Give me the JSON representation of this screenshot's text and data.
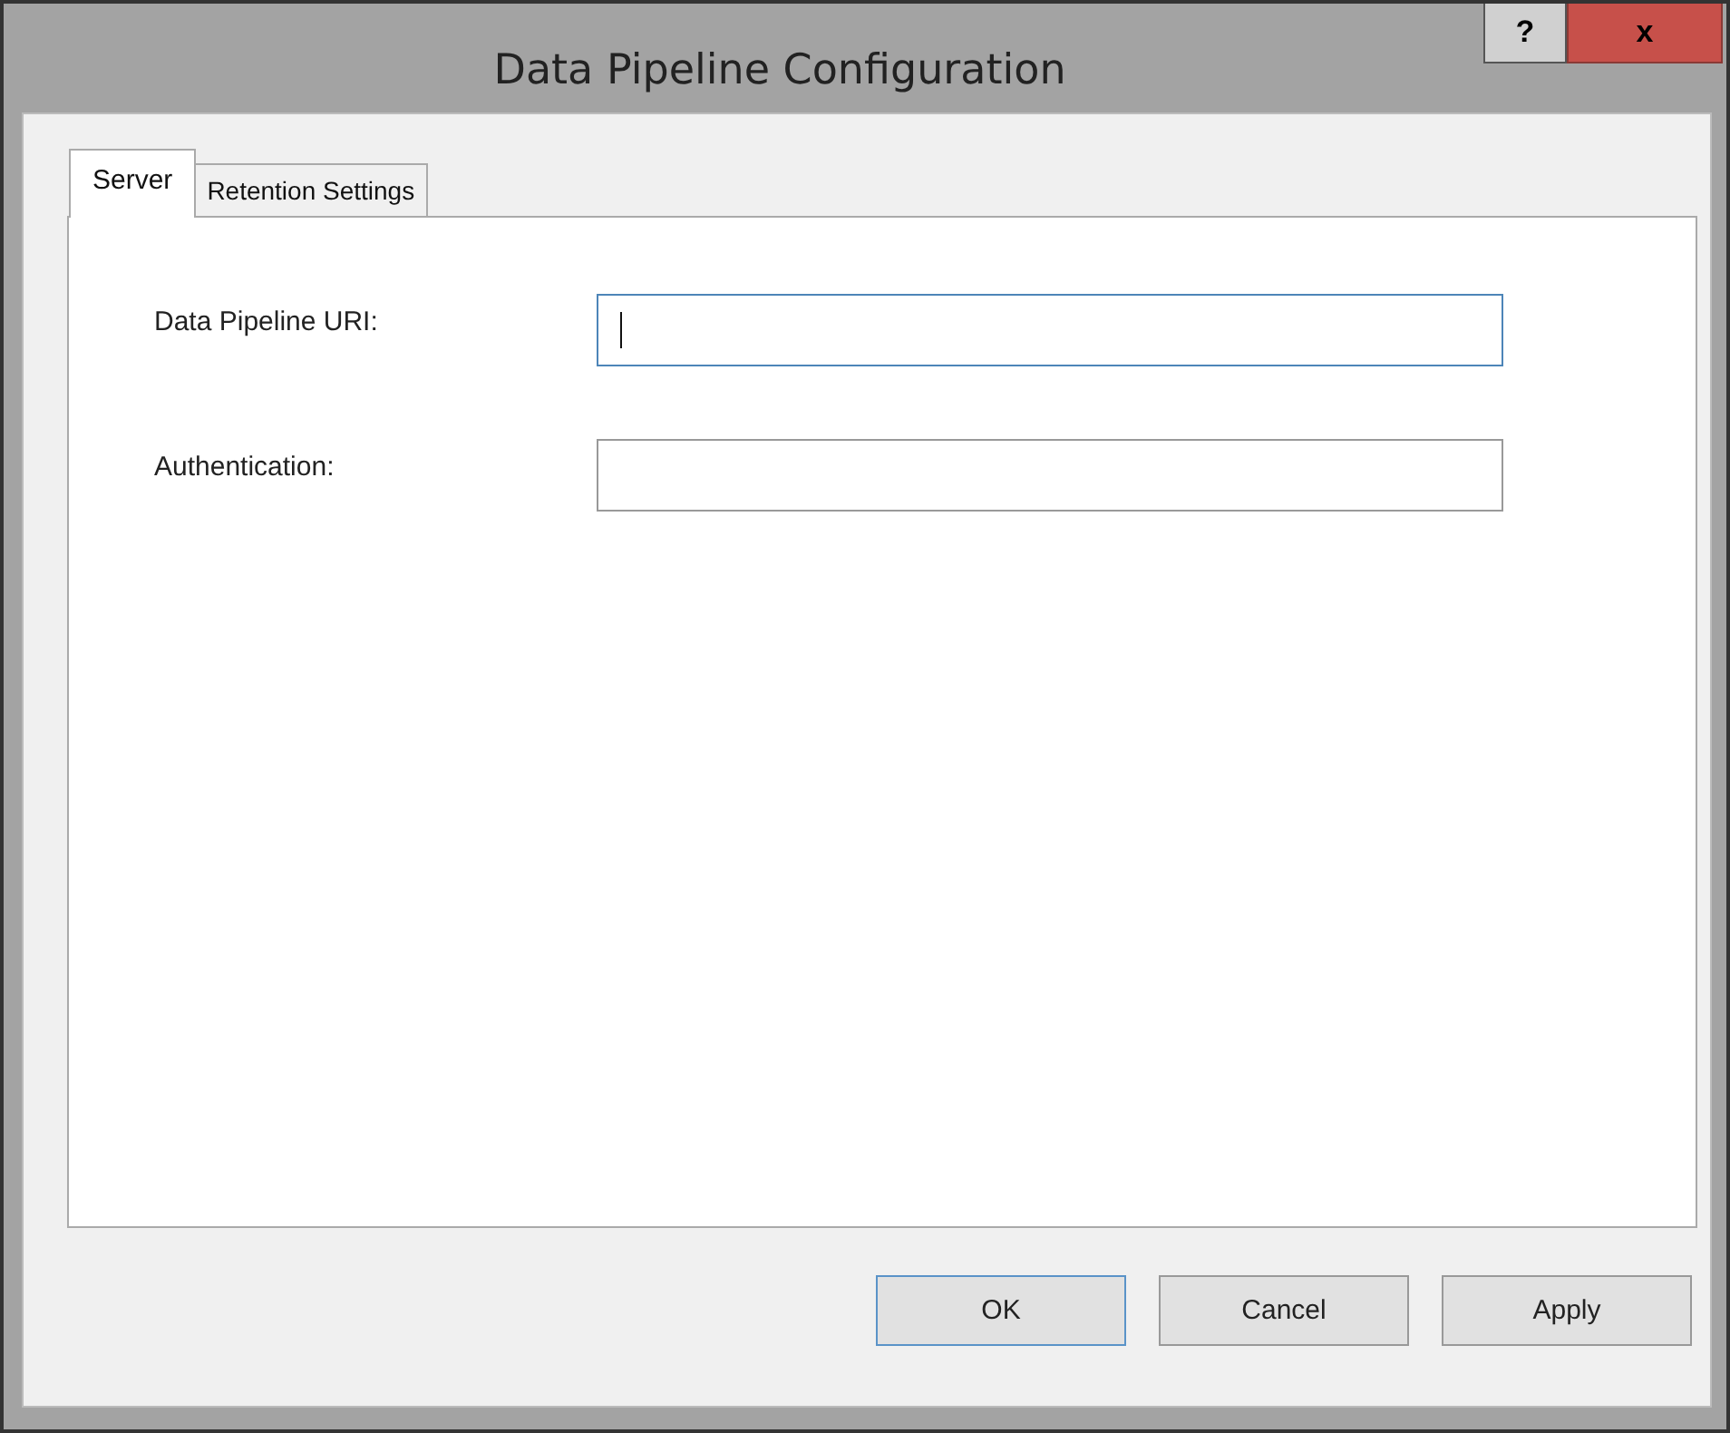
{
  "window": {
    "title": "Data Pipeline Configuration",
    "title_buttons": [
      {
        "kind": "help",
        "label": "?"
      },
      {
        "kind": "close",
        "label": "x"
      }
    ]
  },
  "tabs": [
    {
      "label": "Server",
      "selected": true
    },
    {
      "label": "Retention Settings",
      "selected": false
    }
  ],
  "fields": [
    {
      "label": "Data Pipeline URI:",
      "focused": true
    },
    {
      "label": "Authentication:",
      "focused": false
    }
  ],
  "buttons": [
    {
      "label": "OK",
      "default": true
    },
    {
      "label": "Cancel",
      "default": false
    },
    {
      "label": "Apply",
      "default": false
    }
  ]
}
